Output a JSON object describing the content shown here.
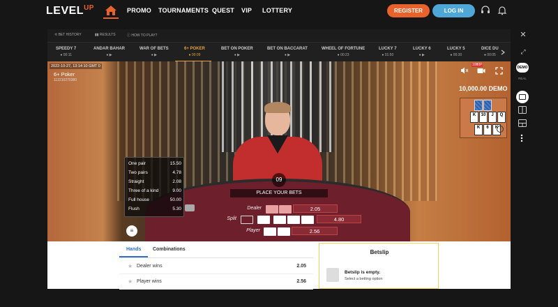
{
  "header": {
    "logo_main": "LEVEL",
    "logo_accent": "UP",
    "nav": [
      "PROMO",
      "TOURNAMENTS",
      "QUEST",
      "VIP",
      "LOTTERY"
    ],
    "register_label": "REGISTER",
    "login_label": "LOG IN",
    "accent_color": "#e8622b",
    "login_color": "#4ea7d6"
  },
  "game_toolbar": {
    "bet_history": "BET HISTORY",
    "results": "RESULTS",
    "how_to_play": "HOW TO PLAY?"
  },
  "tabs": [
    {
      "label": "SPEEDY 7",
      "sub": "● 00:11"
    },
    {
      "label": "ANDAR BAHAR",
      "sub": "● ▶"
    },
    {
      "label": "WAR OF BETS",
      "sub": "● ▶"
    },
    {
      "label": "6+ POKER",
      "sub": "● 00:09",
      "active": true
    },
    {
      "label": "BET ON POKER",
      "sub": "● ▶"
    },
    {
      "label": "BET ON BACCARAT",
      "sub": "● ▶"
    },
    {
      "label": "WHEEL OF FORTUNE",
      "sub": "● 00:23"
    },
    {
      "label": "LUCKY 7",
      "sub": "● 01:50"
    },
    {
      "label": "LUCKY 6",
      "sub": "● ▶"
    },
    {
      "label": "LUCKY 5",
      "sub": "● 00:30"
    },
    {
      "label": "DICE DU",
      "sub": "● 00:05"
    }
  ],
  "video": {
    "datetime": "2022-10-27, 13:14:10 GMT 0",
    "game_name": "6+ Poker",
    "game_id": "112210270380",
    "quality": "1080P",
    "balance": "10,000.00 DEMO",
    "timer": "09",
    "status": "PLACE YOUR BETS"
  },
  "roadmap": {
    "row1": [
      "K",
      "10",
      "J",
      "Q"
    ],
    "row2": [
      "K",
      "6",
      "K"
    ]
  },
  "paytable": [
    {
      "hand": "One pair",
      "odds": "15.50"
    },
    {
      "hand": "Two pairs",
      "odds": "4.78"
    },
    {
      "hand": "Straight",
      "odds": "2.08"
    },
    {
      "hand": "Three of a kind",
      "odds": "9.00"
    },
    {
      "hand": "Full house",
      "odds": "50.00"
    },
    {
      "hand": "Flush",
      "odds": "5.30"
    }
  ],
  "bets": {
    "dealer_label": "Dealer",
    "dealer_odds": "2.05",
    "split_label": "Split",
    "split_odds": "4.80",
    "player_label": "Player",
    "player_odds": "2.56"
  },
  "lower": {
    "tab_hands": "Hands",
    "tab_combinations": "Combinations",
    "rows": [
      {
        "label": "Dealer wins",
        "odds": "2.05"
      },
      {
        "label": "Player wins",
        "odds": "2.56"
      }
    ],
    "betslip_title": "Betslip",
    "betslip_empty": "Betslip is empty.",
    "betslip_hint": "Select a betting option"
  },
  "side": {
    "demo": "DEMO",
    "real": "REAL"
  }
}
